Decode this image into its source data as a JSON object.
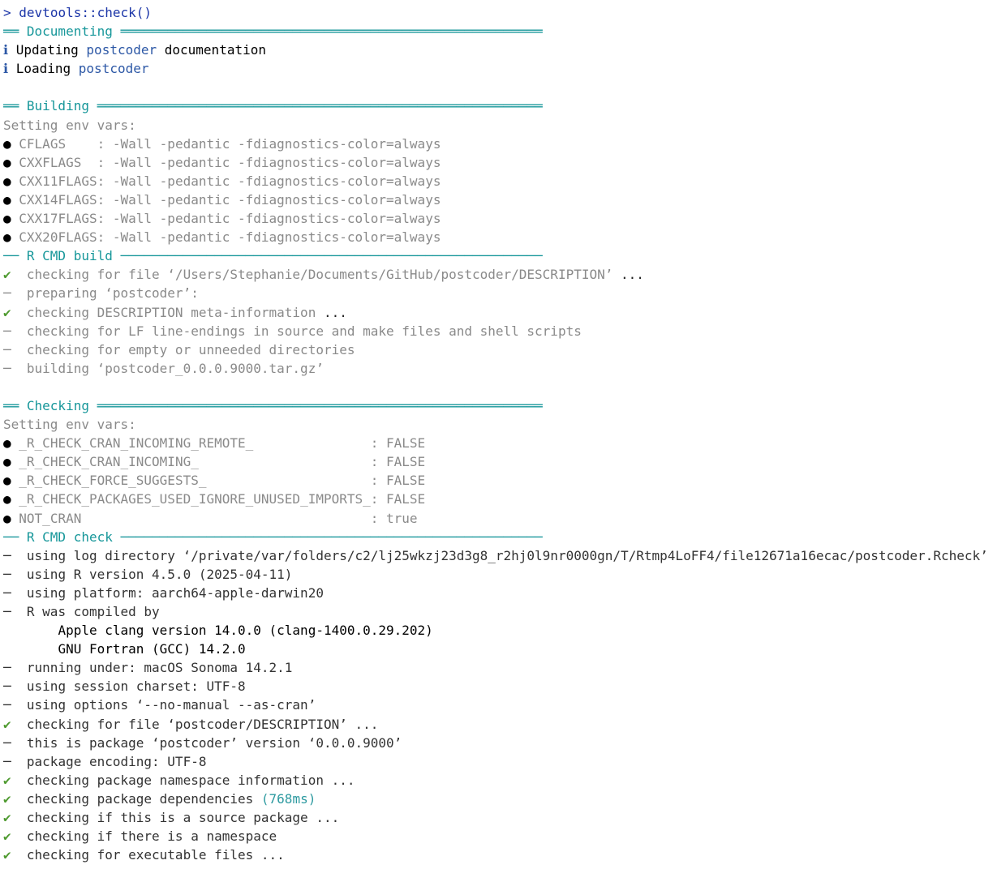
{
  "prompt": {
    "symbol": ">",
    "command": "devtools::check()"
  },
  "symbols": {
    "check": "✔",
    "dash": "─",
    "info": "ℹ",
    "bullet": "●"
  },
  "colors": {
    "prompt": "#1c36a8",
    "section_rule": "#17979a",
    "success": "#4e9a2f",
    "package_name": "#2d58a6",
    "timing": "#2d9aa0",
    "muted": "#8a8a8a"
  },
  "documenting": {
    "header": "══ Documenting ══════════════════════════════════════════════════════",
    "updating_pre": "Updating ",
    "updating_pkg": "postcoder",
    "updating_post": " documentation",
    "loading_pre": "Loading ",
    "loading_pkg": "postcoder"
  },
  "building": {
    "header": "══ Building ═════════════════════════════════════════════════════════",
    "env_label": "Setting env vars:",
    "env": [
      "CFLAGS    : -Wall -pedantic -fdiagnostics-color=always",
      "CXXFLAGS  : -Wall -pedantic -fdiagnostics-color=always",
      "CXX11FLAGS: -Wall -pedantic -fdiagnostics-color=always",
      "CXX14FLAGS: -Wall -pedantic -fdiagnostics-color=always",
      "CXX17FLAGS: -Wall -pedantic -fdiagnostics-color=always",
      "CXX20FLAGS: -Wall -pedantic -fdiagnostics-color=always"
    ]
  },
  "rcmd_build": {
    "header": "── R CMD build ──────────────────────────────────────────────────────",
    "steps": [
      {
        "mark": "✔",
        "text": "checking for file ‘/Users/Stephanie/Documents/GitHub/postcoder/DESCRIPTION’",
        "ellipsis": " ..."
      },
      {
        "mark": "─",
        "text": "preparing ‘postcoder’:",
        "ellipsis": ""
      },
      {
        "mark": "✔",
        "text": "checking DESCRIPTION meta-information",
        "ellipsis": " ..."
      },
      {
        "mark": "─",
        "text": "checking for LF line-endings in source and make files and shell scripts",
        "ellipsis": ""
      },
      {
        "mark": "─",
        "text": "checking for empty or unneeded directories",
        "ellipsis": ""
      },
      {
        "mark": "─",
        "text": "building ‘postcoder_0.0.0.9000.tar.gz’",
        "ellipsis": ""
      }
    ]
  },
  "checking": {
    "header": "══ Checking ═════════════════════════════════════════════════════════",
    "env_label": "Setting env vars:",
    "env": [
      "_R_CHECK_CRAN_INCOMING_REMOTE_               : FALSE",
      "_R_CHECK_CRAN_INCOMING_                      : FALSE",
      "_R_CHECK_FORCE_SUGGESTS_                     : FALSE",
      "_R_CHECK_PACKAGES_USED_IGNORE_UNUSED_IMPORTS_: FALSE",
      "NOT_CRAN                                     : true"
    ]
  },
  "rcmd_check": {
    "header": "── R CMD check ──────────────────────────────────────────────────────",
    "lines": [
      "using log directory ‘/private/var/folders/c2/lj25wkzj23d3g8_r2hj0l9nr0000gn/T/Rtmp4LoFF4/file12671a16ecac/postcoder.Rcheck’",
      "using R version 4.5.0 (2025-04-11)",
      "using platform: aarch64-apple-darwin20",
      "R was compiled by"
    ],
    "compiler_lines": [
      "Apple clang version 14.0.0 (clang-1400.0.29.202)",
      "GNU Fortran (GCC) 14.2.0"
    ],
    "lines2": [
      "running under: macOS Sonoma 14.2.1",
      "using session charset: UTF-8",
      "using options ‘--no-manual --as-cran’"
    ],
    "check_file": "checking for file ‘postcoder/DESCRIPTION’",
    "package_line": "this is package ‘postcoder’ version ‘0.0.0.9000’",
    "encoding_line": "package encoding: UTF-8",
    "ns_info": "checking package namespace information",
    "deps": "checking package dependencies",
    "deps_time": "(768ms)",
    "source_pkg": "checking if this is a source package",
    "has_ns": "checking if there is a namespace",
    "exec_files": "checking for executable files",
    "ellipsis": " ..."
  }
}
